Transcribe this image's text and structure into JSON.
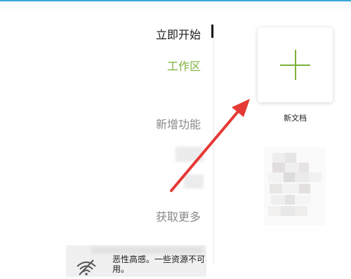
{
  "nav": {
    "start": "立即开始",
    "workspace": "工作区",
    "new_features": "新增功能",
    "get_more": "获取更多"
  },
  "new_document": {
    "label": "新文档"
  },
  "status": {
    "line1": "恶性高感。一些资源不可",
    "line2": "用。"
  },
  "colors": {
    "accent": "#7db13c",
    "arrow": "#e53935",
    "top_rule": "#3aa7d9"
  },
  "icons": {
    "new_document": "plus-icon",
    "status": "offline-wifi-icon"
  }
}
